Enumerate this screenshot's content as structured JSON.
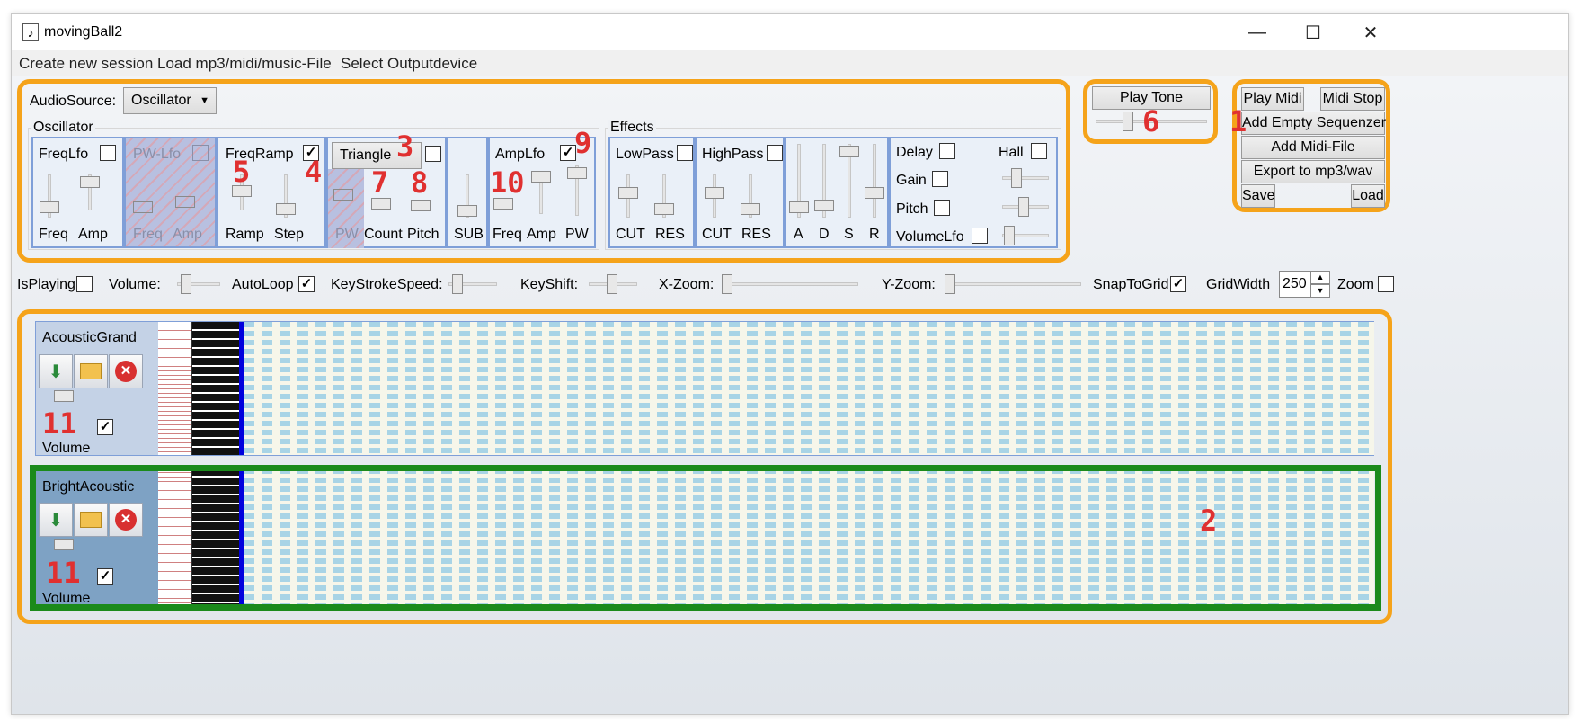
{
  "window": {
    "title": "movingBall2",
    "minimize": "—",
    "maximize": "☐",
    "close": "✕",
    "icon": "♪"
  },
  "menu": [
    "Create new session",
    "Load mp3/midi/music-File",
    "Select Outputdevice"
  ],
  "audio": {
    "label": "AudioSource:",
    "value": "Oscillator"
  },
  "oscillator": {
    "title": "Oscillator",
    "freqlfo": {
      "label": "FreqLfo",
      "checked": false,
      "freq": "Freq",
      "amp": "Amp"
    },
    "pwlfo": {
      "label": "PW-Lfo",
      "checked": false,
      "freq": "Freq",
      "amp": "Amp"
    },
    "freqramp": {
      "label": "FreqRamp",
      "checked": true,
      "ramp": "Ramp",
      "step": "Step"
    },
    "wave": {
      "select": "Triangle",
      "checked": false,
      "pw": "PW",
      "count": "Count",
      "pitch": "Pitch"
    },
    "sub": "SUB",
    "amplfo": {
      "label": "AmpLfo",
      "checked": true,
      "freq": "Freq",
      "amp": "Amp",
      "pw": "PW"
    }
  },
  "effects": {
    "title": "Effects",
    "lowpass": {
      "label": "LowPass",
      "cut": "CUT",
      "res": "RES"
    },
    "highpass": {
      "label": "HighPass",
      "cut": "CUT",
      "res": "RES"
    },
    "adsr": [
      "A",
      "D",
      "S",
      "R"
    ],
    "delay": "Delay",
    "gain": "Gain",
    "pitch": "Pitch",
    "volumelfo": "VolumeLfo",
    "hall": "Hall"
  },
  "playtone": "Play Tone",
  "midi": {
    "play": "Play Midi",
    "stop": "Midi Stop",
    "add_empty": "Add Empty Sequenzer",
    "add_file": "Add Midi-File",
    "export": "Export to mp3/wav",
    "save": "Save",
    "load": "Load"
  },
  "toolbar": {
    "isplaying": "IsPlaying",
    "volume": "Volume:",
    "autoloop": "AutoLoop",
    "keystroke": "KeyStrokeSpeed:",
    "keyshift": "KeyShift:",
    "xzoom": "X-Zoom:",
    "yzoom": "Y-Zoom:",
    "snap": "SnapToGrid",
    "gridwidth": "GridWidth",
    "gridwidth_value": "250",
    "zoom": "Zoom"
  },
  "tracks": [
    {
      "name": "AcousticGrand",
      "volume": "Volume",
      "checked": true
    },
    {
      "name": "BrightAcoustic",
      "volume": "Volume",
      "checked": true
    }
  ],
  "annotations": {
    "n1": "1",
    "n2": "2",
    "n3": "3",
    "n4": "4",
    "n5": "5",
    "n6": "6",
    "n7": "7",
    "n8": "8",
    "n9": "9",
    "n10": "10",
    "n11a": "11",
    "n11b": "11"
  },
  "colors": {
    "orange": "#f5a31a",
    "green": "#1b8a1b",
    "annotation": "#e03030",
    "panel_border": "#7f9fd8",
    "playhead": "#0000dd"
  }
}
